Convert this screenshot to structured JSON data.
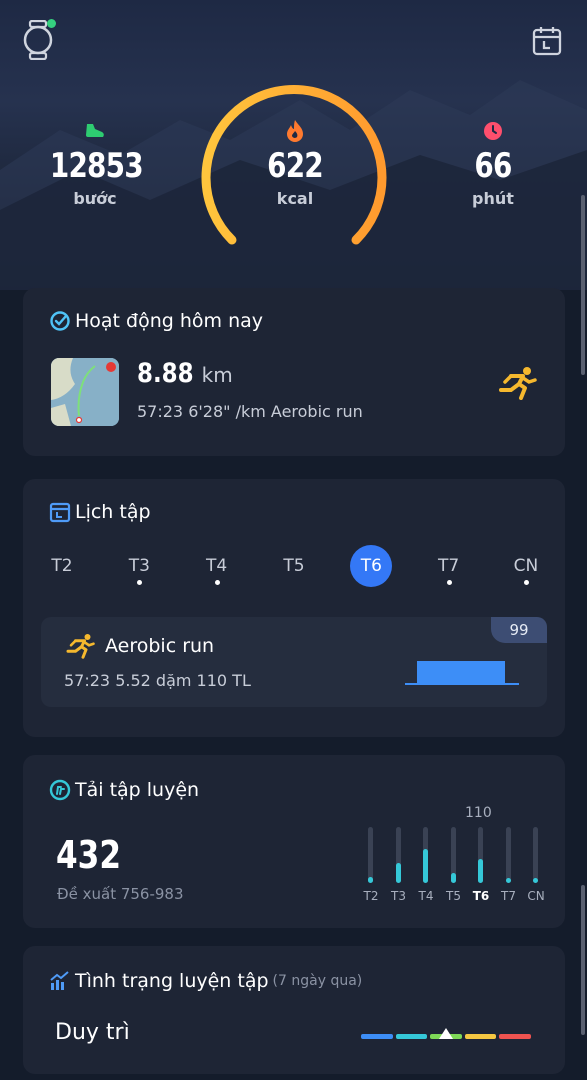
{
  "header": {
    "watch_icon": "smartwatch-icon",
    "calendar_icon": "calendar-icon",
    "colors": {
      "online": "#35d07f"
    }
  },
  "stats": {
    "steps": {
      "value": "12853",
      "unit": "bước",
      "icon": "shoe-icon",
      "color": "#2ecc71"
    },
    "calories": {
      "value": "622",
      "unit": "kcal",
      "icon": "flame-icon",
      "color": "#ff7a2f"
    },
    "minutes": {
      "value": "66",
      "unit": "phút",
      "icon": "clock-icon",
      "color": "#ff4f6d"
    },
    "ring_colors": [
      "#ffc53d",
      "#ff9a2e"
    ]
  },
  "activity_today": {
    "title": "Hoạt động hôm nay",
    "distance_value": "8.88",
    "distance_unit": "km",
    "details": "57:23 6'28\" /km  Aerobic run",
    "icon": "check-circle-icon",
    "run_icon": "running-icon"
  },
  "schedule": {
    "title": "Lịch tập",
    "days": [
      {
        "label": "T2",
        "has_workout": false,
        "active": false
      },
      {
        "label": "T3",
        "has_workout": true,
        "active": false
      },
      {
        "label": "T4",
        "has_workout": true,
        "active": false
      },
      {
        "label": "T5",
        "has_workout": false,
        "active": false
      },
      {
        "label": "T6",
        "has_workout": false,
        "active": true
      },
      {
        "label": "T7",
        "has_workout": true,
        "active": false
      },
      {
        "label": "CN",
        "has_workout": true,
        "active": false
      }
    ],
    "workout": {
      "name": "Aerobic run",
      "meta": "57:23   5.52 dặm   110 TL",
      "badge": "99"
    },
    "accent": "#3478f6"
  },
  "training_load": {
    "title": "Tải tập luyện",
    "value": "432",
    "suggestion": "Đề xuất 756-983",
    "peak_label": "110",
    "peak_day_index": 4,
    "days": [
      {
        "label": "T2",
        "level": 0.1
      },
      {
        "label": "T3",
        "level": 0.35
      },
      {
        "label": "T4",
        "level": 0.6
      },
      {
        "label": "T5",
        "level": 0.18
      },
      {
        "label": "T6",
        "level": 0.42
      },
      {
        "label": "T7",
        "level": 0
      },
      {
        "label": "CN",
        "level": 0
      }
    ],
    "bar_color": "#35c8d8"
  },
  "training_status": {
    "title": "Tình trạng luyện tập",
    "subtitle": "(7 ngày qua)",
    "value": "Duy trì",
    "scale_colors": [
      "#3d8ef7",
      "#35c8d8",
      "#7ed957",
      "#f5c742",
      "#ef5350"
    ],
    "pointer_position": 0.5
  }
}
